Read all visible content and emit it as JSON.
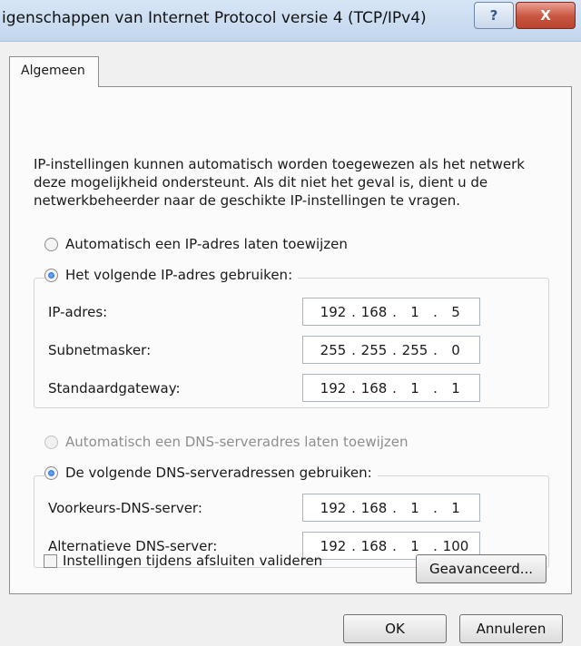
{
  "window": {
    "title": "igenschappen van Internet Protocol versie 4 (TCP/IPv4)",
    "help_label": "?",
    "close_label": "X"
  },
  "tabs": [
    {
      "label": "Algemeen",
      "selected": true
    }
  ],
  "intro_text": "IP-instellingen kunnen automatisch worden toegewezen als het netwerk deze mogelijkheid ondersteunt. Als dit niet het geval is, dient u de netwerkbeheerder naar de geschikte IP-instellingen te vragen.",
  "ip_section": {
    "auto_option": {
      "label": "Automatisch een IP-adres laten toewijzen",
      "selected": false
    },
    "manual_option": {
      "label": "Het volgende IP-adres gebruiken:",
      "selected": true
    },
    "fields": [
      {
        "label": "IP-adres:",
        "octets": [
          "192",
          "168",
          "1",
          "5"
        ]
      },
      {
        "label": "Subnetmasker:",
        "octets": [
          "255",
          "255",
          "255",
          "0"
        ]
      },
      {
        "label": "Standaardgateway:",
        "octets": [
          "192",
          "168",
          "1",
          "1"
        ]
      }
    ]
  },
  "dns_section": {
    "auto_option": {
      "label": "Automatisch een DNS-serveradres laten toewijzen",
      "selected": false,
      "disabled": true
    },
    "manual_option": {
      "label": "De volgende DNS-serveradressen gebruiken:",
      "selected": true
    },
    "fields": [
      {
        "label": "Voorkeurs-DNS-server:",
        "octets": [
          "192",
          "168",
          "1",
          "1"
        ]
      },
      {
        "label": "Alternatieve DNS-server:",
        "octets": [
          "192",
          "168",
          "1",
          "100"
        ]
      }
    ]
  },
  "validate_checkbox": {
    "label": "Instellingen tijdens afsluiten valideren",
    "checked": false
  },
  "buttons": {
    "advanced": "Geavanceerd...",
    "ok": "OK",
    "cancel": "Annuleren"
  }
}
